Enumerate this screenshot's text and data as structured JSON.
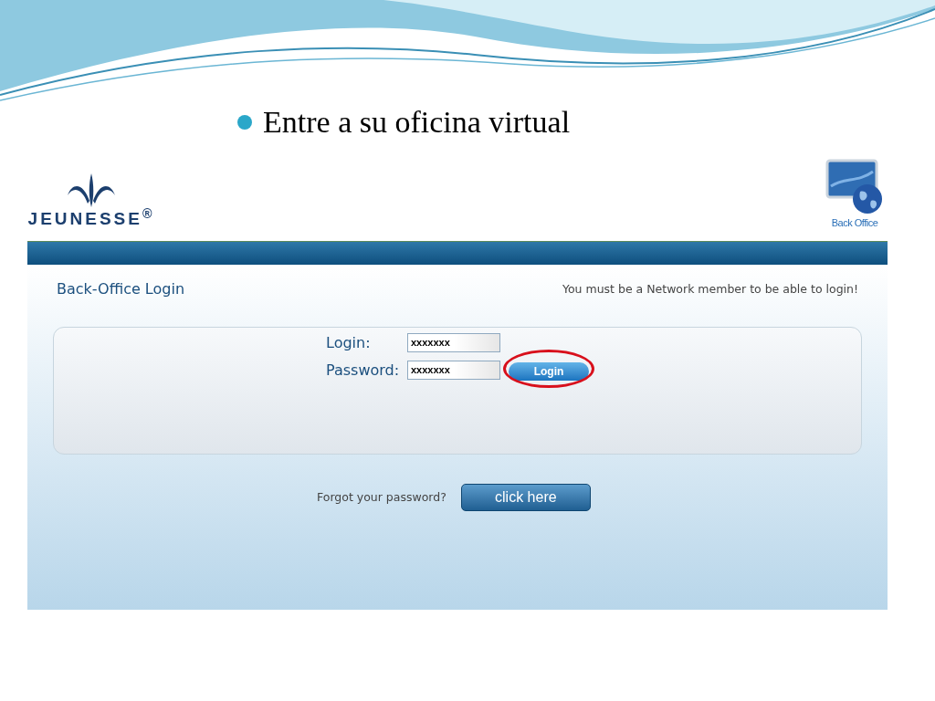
{
  "slide": {
    "bullet_title": "Entre a su oficina virtual"
  },
  "header": {
    "logo_text": "JEUNESSE$^{®}$",
    "back_office_label": "Back Office"
  },
  "login_page": {
    "title": "Back-Office Login",
    "notice": "You must be a Network member to be able to login!",
    "fields": [
      {
        "label": "Login:",
        "value": "xxxxxxx"
      },
      {
        "label": "Password:",
        "value": "xxxxxxx"
      }
    ],
    "login_button": "Login",
    "forgot_text": "Forgot your password?",
    "forgot_button": "click here"
  }
}
